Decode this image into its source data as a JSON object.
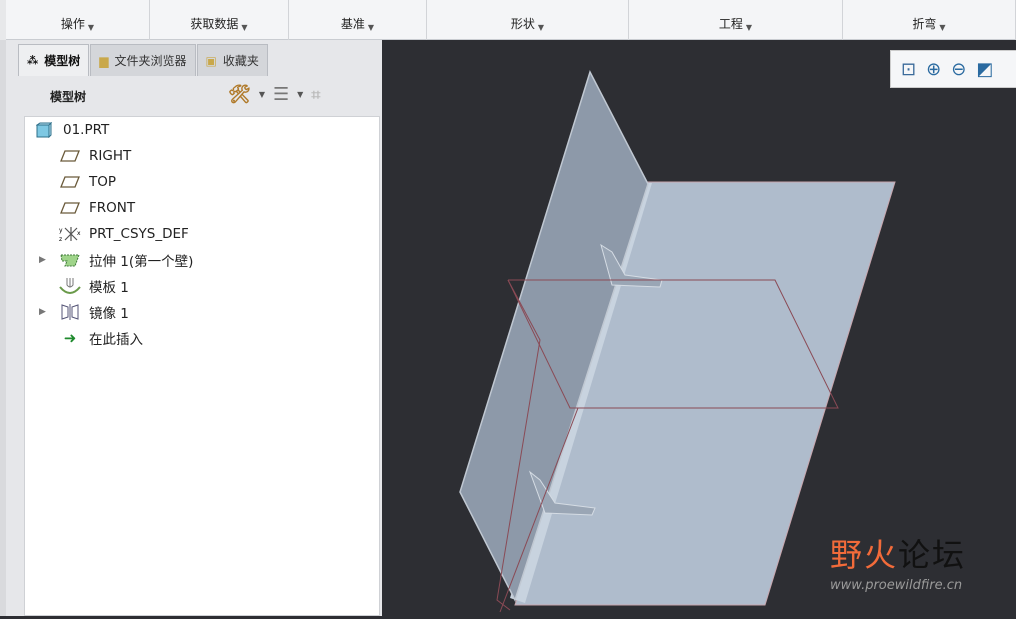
{
  "ribbon": {
    "groups": [
      {
        "label": "操作"
      },
      {
        "label": "获取数据"
      },
      {
        "label": "基准"
      },
      {
        "label": "形状"
      },
      {
        "label": "工程"
      },
      {
        "label": "折弯"
      }
    ]
  },
  "tabs": [
    {
      "label": "模型树"
    },
    {
      "label": "文件夹浏览器"
    },
    {
      "label": "收藏夹"
    }
  ],
  "tree": {
    "title": "模型树",
    "items": [
      {
        "label": "01.PRT",
        "icon": "part-icon"
      },
      {
        "label": "RIGHT",
        "icon": "datum-plane-icon"
      },
      {
        "label": "TOP",
        "icon": "datum-plane-icon"
      },
      {
        "label": "FRONT",
        "icon": "datum-plane-icon"
      },
      {
        "label": "PRT_CSYS_DEF",
        "icon": "csys-icon"
      },
      {
        "label": "拉伸 1(第一个壁)",
        "icon": "extrude-wall-icon"
      },
      {
        "label": "模板 1",
        "icon": "form-icon"
      },
      {
        "label": "镜像 1",
        "icon": "mirror-icon"
      },
      {
        "label": "在此插入",
        "icon": "insert-here-icon"
      }
    ]
  },
  "watermark": {
    "name": "野火论坛",
    "url": "www.proewildfire.cn"
  },
  "colors": {
    "viewport": "#2d2e33",
    "part": "#aebccd",
    "wall": "#8c98a8",
    "datum": "#8a4a55",
    "accent": "#f26b3a"
  }
}
